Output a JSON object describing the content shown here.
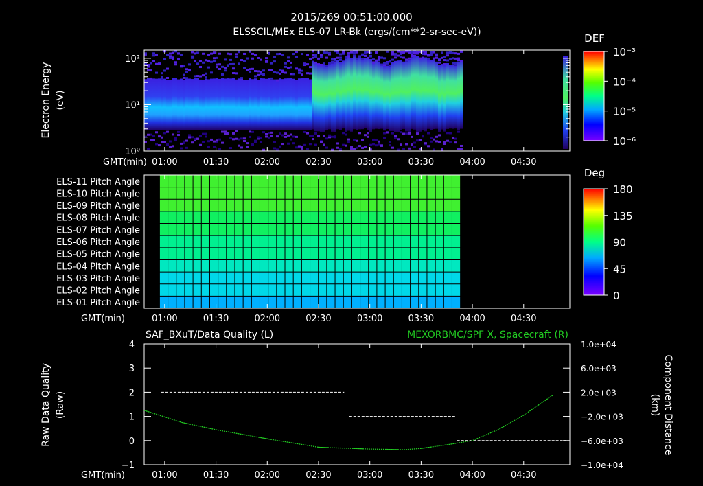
{
  "header": {
    "timestamp": "2015/269 00:51:00.000",
    "subtitle": "ELSSCIL/MEx ELS-07 LR-Bk  (ergs/(cm**2-sr-sec-eV))"
  },
  "colors": {
    "background": "#000000",
    "axis": "#ffffff",
    "grid": "#000000",
    "right_series": "#22cc22",
    "quality_ticks": "#ffffff"
  },
  "time_axis": {
    "label": "GMT(min)",
    "ticks": [
      "01:00",
      "01:30",
      "02:00",
      "02:30",
      "03:00",
      "03:30",
      "04:00",
      "04:30"
    ]
  },
  "chart_data": [
    {
      "type": "heatmap",
      "panel": "spectrogram",
      "ylabel": [
        "Electron Energy",
        "(eV)"
      ],
      "yscale": "log",
      "ylim": [
        1,
        150
      ],
      "y_ticks": [
        "10⁰",
        "10¹",
        "10²"
      ],
      "xlabel": "GMT(min)",
      "x_ticks": [
        "01:00",
        "01:30",
        "02:00",
        "02:30",
        "03:00",
        "03:30",
        "04:00",
        "04:30"
      ],
      "colorbar": {
        "title": "DEF",
        "scale": "log",
        "range": [
          1e-06,
          0.001
        ],
        "labels": [
          "10⁻³",
          "10⁻⁴",
          "10⁻⁵",
          "10⁻⁶"
        ]
      },
      "data_coverage_end": "03:53"
    },
    {
      "type": "heatmap",
      "panel": "pitch_angle",
      "rows": [
        "ELS-11 Pitch Angle",
        "ELS-10 Pitch Angle",
        "ELS-09 Pitch Angle",
        "ELS-08 Pitch Angle",
        "ELS-07 Pitch Angle",
        "ELS-06 Pitch Angle",
        "ELS-05 Pitch Angle",
        "ELS-04 Pitch Angle",
        "ELS-03 Pitch Angle",
        "ELS-02 Pitch Angle",
        "ELS-01 Pitch Angle"
      ],
      "row_values_deg": [
        95,
        93,
        90,
        86,
        82,
        78,
        73,
        68,
        62,
        56,
        50
      ],
      "xlabel": "GMT(min)",
      "x_ticks": [
        "01:00",
        "01:30",
        "02:00",
        "02:30",
        "03:00",
        "03:30",
        "04:00",
        "04:30"
      ],
      "columns": 36,
      "data_coverage_end": "03:53",
      "colorbar": {
        "title": "Deg",
        "range": [
          0,
          180
        ],
        "labels": [
          "180",
          "135",
          "90",
          "45",
          "0"
        ]
      }
    },
    {
      "type": "line",
      "panel": "timeseries",
      "left_title": "SAF_BXuT/Data Quality (L)",
      "right_title": "MEXORBMC/SPF X, Spacecraft (R)",
      "ylabel_left": [
        "Raw Data Quality",
        "(Raw)"
      ],
      "ylabel_right": [
        "Component Distance",
        "(km)"
      ],
      "xlabel": "GMT(min)",
      "x_ticks": [
        "01:00",
        "01:30",
        "02:00",
        "02:30",
        "03:00",
        "03:30",
        "04:00",
        "04:30"
      ],
      "ylim_left": [
        -1,
        4
      ],
      "left_tick_labels": [
        "4",
        "3",
        "2",
        "1",
        "0",
        "−1"
      ],
      "ylim_right": [
        -10000,
        10000
      ],
      "right_tick_labels": [
        "1.0e+04",
        "6.0e+03",
        "2.0e+03",
        "−2.0e+03",
        "−6.0e+03",
        "−1.0e+04"
      ],
      "series": [
        {
          "name": "SAF_BXuT/Data Quality (L)",
          "axis": "left",
          "segments": [
            {
              "start": "00:58",
              "end": "02:45",
              "value": 2
            },
            {
              "start": "02:48",
              "end": "03:50",
              "value": 1
            },
            {
              "start": "03:51",
              "end": "04:55",
              "value": 0
            }
          ]
        },
        {
          "name": "MEXORBMC/SPF X, Spacecraft (R)",
          "axis": "right",
          "x": [
            "00:48",
            "01:10",
            "01:30",
            "02:00",
            "02:30",
            "03:00",
            "03:20",
            "03:30",
            "03:45",
            "04:00",
            "04:15",
            "04:30",
            "04:47"
          ],
          "values": [
            -1000,
            -3000,
            -4200,
            -5700,
            -7100,
            -7400,
            -7500,
            -7300,
            -6700,
            -6000,
            -4200,
            -1800,
            1500
          ]
        }
      ]
    }
  ]
}
